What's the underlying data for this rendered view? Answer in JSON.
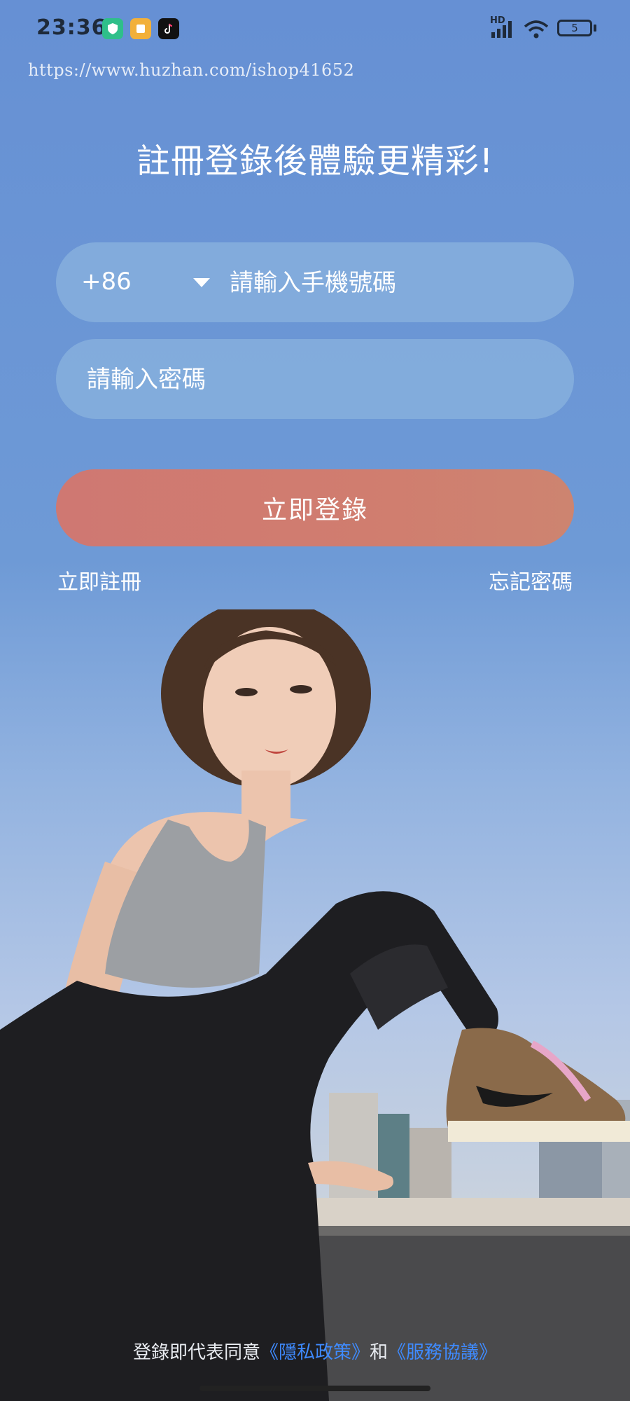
{
  "status_bar": {
    "time": "23:36",
    "network_label": "HD",
    "battery_level": "5",
    "icons": [
      "shield-app-icon",
      "notes-app-icon",
      "tiktok-icon",
      "signal-icon",
      "wifi-icon",
      "battery-icon"
    ]
  },
  "watermark": "https://www.huzhan.com/ishop41652",
  "headline": "註冊登錄後體驗更精彩!",
  "phone_field": {
    "country_code": "+86",
    "placeholder": "請輸入手機號碼"
  },
  "password_field": {
    "placeholder": "請輸入密碼"
  },
  "login_button": "立即登錄",
  "register_link": "立即註冊",
  "forgot_link": "忘記密碼",
  "agreement": {
    "prefix": "登錄即代表同意",
    "privacy": "《隱私政策》",
    "joiner": "和",
    "terms": "《服務協議》"
  },
  "colors": {
    "background": "#6b93d2",
    "login_button": "#cf7872",
    "policy_link": "#3f8bff"
  }
}
